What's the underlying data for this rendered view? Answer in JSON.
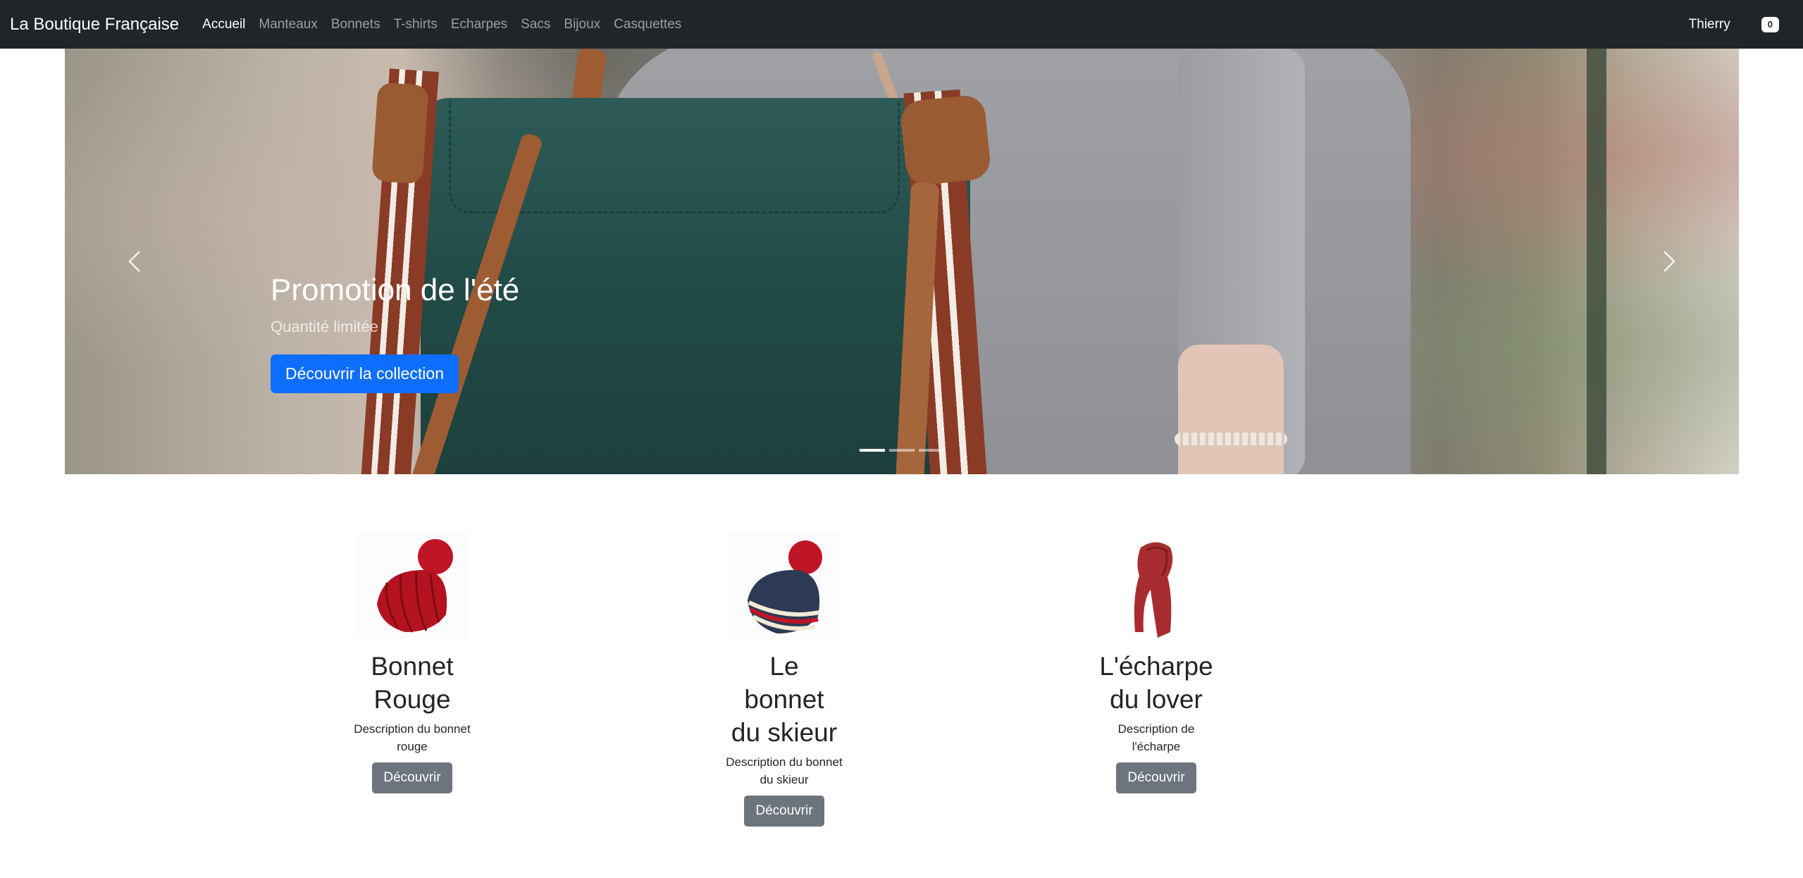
{
  "navbar": {
    "brand": "La Boutique Française",
    "links": [
      "Accueil",
      "Manteaux",
      "Bonnets",
      "T-shirts",
      "Echarpes",
      "Sacs",
      "Bijoux",
      "Casquettes"
    ],
    "active_link": "Accueil",
    "user_name": "Thierry",
    "cart_count": "0"
  },
  "carousel": {
    "title": "Promotion de l'été",
    "subtitle": "Quantité limitée",
    "button_label": "Découvrir la collection",
    "prev_icon": "chevron-left-icon",
    "next_icon": "chevron-right-icon",
    "slide_count": 3,
    "active_slide": 1
  },
  "products": [
    {
      "title_lines": [
        "Bonnet",
        "Rouge"
      ],
      "description_lines": [
        "Description du bonnet",
        "rouge"
      ],
      "button_label": "Découvrir",
      "image": "red-beanie"
    },
    {
      "title_lines": [
        "Le",
        "bonnet",
        "du skieur"
      ],
      "description_lines": [
        "Description du bonnet",
        "du skieur"
      ],
      "button_label": "Découvrir",
      "image": "navy-ski-beanie"
    },
    {
      "title_lines": [
        "L'écharpe",
        "du lover"
      ],
      "description_lines": [
        "Description de",
        "l'écharpe"
      ],
      "button_label": "Découvrir",
      "image": "red-scarf"
    }
  ],
  "colors": {
    "navbar_bg": "#212529",
    "primary": "#0d6efd",
    "secondary": "#6c757d"
  }
}
